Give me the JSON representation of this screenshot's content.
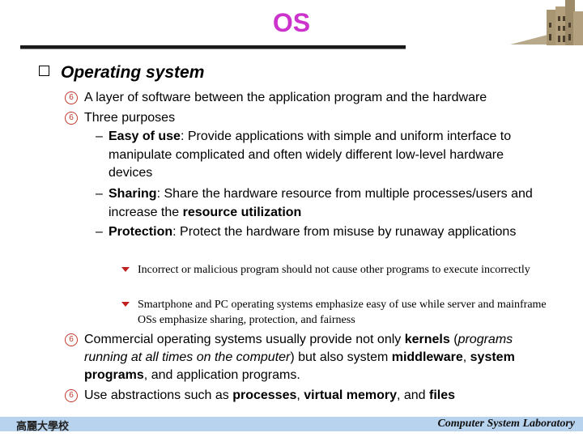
{
  "slide": {
    "title": "OS",
    "title_color": "#cc33cc"
  },
  "heading": {
    "bullet_icon": "hollow-square-icon",
    "text": "Operating system"
  },
  "items": [
    {
      "icon": "circled-six-icon",
      "parts": [
        {
          "t": "A layer of software between the application program and the hardware",
          "b": false
        }
      ]
    },
    {
      "icon": "circled-six-icon",
      "parts": [
        {
          "t": "Three purposes",
          "b": false
        }
      ]
    }
  ],
  "purposes": [
    {
      "parts": [
        {
          "t": "Easy of use",
          "b": true
        },
        {
          "t": ": Provide applications with simple and uniform interface to manipulate complicated and often widely different low-level hardware devices",
          "b": false
        }
      ]
    },
    {
      "parts": [
        {
          "t": "Sharing",
          "b": true
        },
        {
          "t": ": Share the hardware resource from multiple processes/users and increase the ",
          "b": false
        },
        {
          "t": "resource utilization",
          "b": true
        }
      ]
    },
    {
      "parts": [
        {
          "t": "Protection",
          "b": true
        },
        {
          "t": ": Protect the hardware from misuse by runaway applications",
          "b": false
        }
      ]
    }
  ],
  "notes": [
    "Incorrect or malicious program should not cause other programs to execute incorrectly",
    "Smartphone and PC operating systems emphasize easy of use while server and mainframe OSs emphasize sharing, protection, and fairness"
  ],
  "items2": [
    {
      "icon": "circled-six-icon",
      "parts": [
        {
          "t": "Commercial operating systems usually provide not only ",
          "b": false
        },
        {
          "t": "kernels",
          "b": true
        },
        {
          "t": " (",
          "b": false
        },
        {
          "t": "programs running at all times on the computer",
          "i": true
        },
        {
          "t": ") but also system ",
          "b": false
        },
        {
          "t": "middleware",
          "b": true
        },
        {
          "t": ", ",
          "b": false
        },
        {
          "t": "system programs",
          "b": true
        },
        {
          "t": ", and application programs.",
          "b": false
        }
      ]
    },
    {
      "icon": "circled-six-icon",
      "parts": [
        {
          "t": "Use abstractions such as ",
          "b": false
        },
        {
          "t": "processes",
          "b": true
        },
        {
          "t": ", ",
          "b": false
        },
        {
          "t": "virtual memory",
          "b": true
        },
        {
          "t": ", and ",
          "b": false
        },
        {
          "t": "files",
          "b": true
        }
      ]
    }
  ],
  "footer": {
    "left": "高麗大學校",
    "right": "Computer System Laboratory"
  }
}
